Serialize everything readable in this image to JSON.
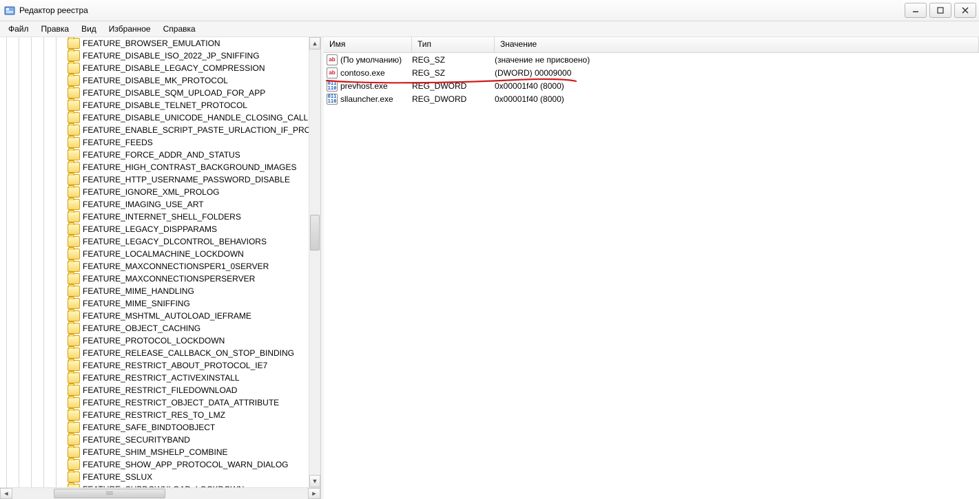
{
  "window": {
    "title": "Редактор реестра"
  },
  "menu": {
    "file": "Файл",
    "edit": "Правка",
    "view": "Вид",
    "favorites": "Избранное",
    "help": "Справка"
  },
  "tree": {
    "items": [
      "FEATURE_BROWSER_EMULATION",
      "FEATURE_DISABLE_ISO_2022_JP_SNIFFING",
      "FEATURE_DISABLE_LEGACY_COMPRESSION",
      "FEATURE_DISABLE_MK_PROTOCOL",
      "FEATURE_DISABLE_SQM_UPLOAD_FOR_APP",
      "FEATURE_DISABLE_TELNET_PROTOCOL",
      "FEATURE_DISABLE_UNICODE_HANDLE_CLOSING_CALLBACK",
      "FEATURE_ENABLE_SCRIPT_PASTE_URLACTION_IF_PROMPT",
      "FEATURE_FEEDS",
      "FEATURE_FORCE_ADDR_AND_STATUS",
      "FEATURE_HIGH_CONTRAST_BACKGROUND_IMAGES",
      "FEATURE_HTTP_USERNAME_PASSWORD_DISABLE",
      "FEATURE_IGNORE_XML_PROLOG",
      "FEATURE_IMAGING_USE_ART",
      "FEATURE_INTERNET_SHELL_FOLDERS",
      "FEATURE_LEGACY_DISPPARAMS",
      "FEATURE_LEGACY_DLCONTROL_BEHAVIORS",
      "FEATURE_LOCALMACHINE_LOCKDOWN",
      "FEATURE_MAXCONNECTIONSPER1_0SERVER",
      "FEATURE_MAXCONNECTIONSPERSERVER",
      "FEATURE_MIME_HANDLING",
      "FEATURE_MIME_SNIFFING",
      "FEATURE_MSHTML_AUTOLOAD_IEFRAME",
      "FEATURE_OBJECT_CACHING",
      "FEATURE_PROTOCOL_LOCKDOWN",
      "FEATURE_RELEASE_CALLBACK_ON_STOP_BINDING",
      "FEATURE_RESTRICT_ABOUT_PROTOCOL_IE7",
      "FEATURE_RESTRICT_ACTIVEXINSTALL",
      "FEATURE_RESTRICT_FILEDOWNLOAD",
      "FEATURE_RESTRICT_OBJECT_DATA_ATTRIBUTE",
      "FEATURE_RESTRICT_RES_TO_LMZ",
      "FEATURE_SAFE_BINDTOOBJECT",
      "FEATURE_SECURITYBAND",
      "FEATURE_SHIM_MSHELP_COMBINE",
      "FEATURE_SHOW_APP_PROTOCOL_WARN_DIALOG",
      "FEATURE_SSLUX",
      "FEATURE_SUBDOWNLOAD_LOCKDOWN"
    ]
  },
  "list": {
    "columns": {
      "name": "Имя",
      "type": "Тип",
      "value": "Значение"
    },
    "rows": [
      {
        "icon": "sz",
        "name": "(По умолчанию)",
        "type": "REG_SZ",
        "value": "(значение не присвоено)"
      },
      {
        "icon": "sz",
        "name": "contoso.exe",
        "type": "REG_SZ",
        "value": "(DWORD) 00009000"
      },
      {
        "icon": "dw",
        "name": "prevhost.exe",
        "type": "REG_DWORD",
        "value": "0x00001f40 (8000)"
      },
      {
        "icon": "dw",
        "name": "sllauncher.exe",
        "type": "REG_DWORD",
        "value": "0x00001f40 (8000)"
      }
    ]
  },
  "icon_glyphs": {
    "sz": "ab",
    "dw": "011\n110"
  }
}
